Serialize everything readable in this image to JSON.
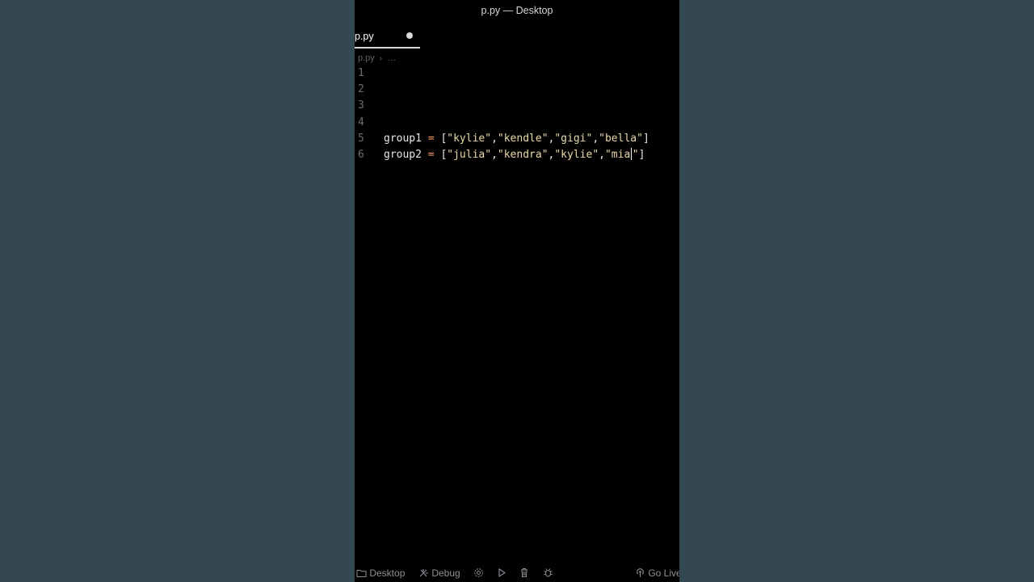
{
  "window": {
    "title": "p.py — Desktop"
  },
  "tab": {
    "label": "p.py",
    "modified": true
  },
  "breadcrumb": {
    "file": "p.py",
    "separator": "›",
    "more": "…"
  },
  "editor": {
    "lines": [
      {
        "number": "1",
        "code": ""
      },
      {
        "number": "2",
        "code": ""
      },
      {
        "number": "3",
        "code": ""
      },
      {
        "number": "4",
        "code": ""
      },
      {
        "number": "5",
        "name": "group1",
        "op": "=",
        "items": [
          "\"kylie\"",
          "\"kendle\"",
          "\"gigi\"",
          "\"bella\""
        ]
      },
      {
        "number": "6",
        "name": "group2",
        "op": "=",
        "items": [
          "\"julia\"",
          "\"kendra\"",
          "\"kylie\"",
          "\"mia\""
        ]
      }
    ]
  },
  "status_bar": {
    "folder": "Desktop",
    "debug": "Debug",
    "go_live": "Go Live",
    "icons": [
      "folder-icon",
      "debug-icon",
      "gear-icon",
      "run-icon",
      "trash-icon",
      "bug-icon",
      "broadcast-icon"
    ]
  },
  "colors": {
    "background": "#334850",
    "editor": "#000000",
    "operator": "#ff9d5c",
    "string": "#e8d9a8"
  }
}
